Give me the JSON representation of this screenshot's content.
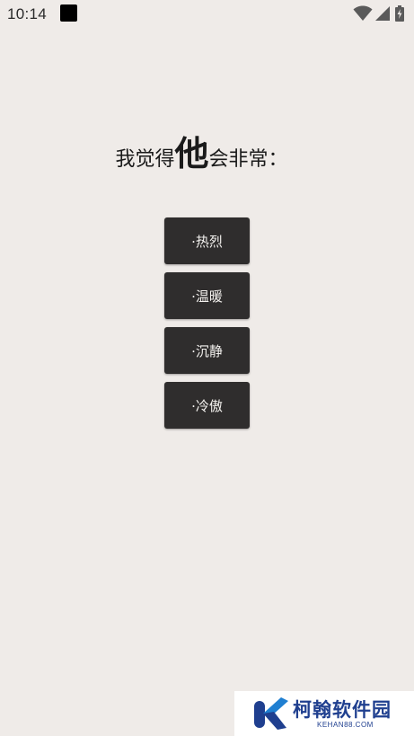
{
  "status_bar": {
    "time": "10:14",
    "icons": [
      "wifi-icon",
      "signal-icon",
      "battery-charging-icon"
    ]
  },
  "question": {
    "prefix": "我觉得",
    "emphasis": "他",
    "suffix": "会非常："
  },
  "options": [
    {
      "label": "·热烈"
    },
    {
      "label": "·温暖"
    },
    {
      "label": "·沉静"
    },
    {
      "label": "·冷傲"
    }
  ],
  "watermark": {
    "title": "柯翰软件园",
    "subtitle": "KEHAN88.COM"
  },
  "colors": {
    "background": "#efebe8",
    "button": "#2f2d2d",
    "button_text": "#f3f1ee",
    "watermark_blue": "#1f3f8f"
  }
}
